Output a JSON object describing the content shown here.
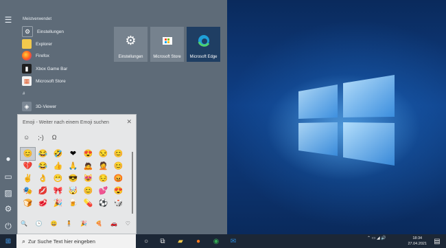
{
  "start_menu": {
    "section_most_used": "Meistverwendet",
    "section_hash": "#",
    "apps": [
      {
        "label": "Einstellungen",
        "icon": "gear-icon"
      },
      {
        "label": "Explorer",
        "icon": "folder-icon"
      },
      {
        "label": "Firefox",
        "icon": "firefox-icon"
      },
      {
        "label": "Xbox Game Bar",
        "icon": "xbox-icon"
      },
      {
        "label": "Microsoft Store",
        "icon": "store-icon"
      },
      {
        "label": "3D-Viewer",
        "icon": "cube-icon"
      }
    ],
    "tiles": [
      {
        "label": "Einstellungen",
        "icon": "gear-icon"
      },
      {
        "label": "Microsoft Store",
        "icon": "store-icon"
      },
      {
        "label": "Microsoft Edge",
        "icon": "edge-icon"
      }
    ]
  },
  "emoji_panel": {
    "header": "Emoji - Weiter nach einem Emoji suchen",
    "tabs": [
      "☺",
      ";-)",
      "Ω"
    ],
    "emojis": [
      "😊",
      "😂",
      "🤣",
      "❤",
      "😍",
      "😒",
      "😊",
      "💔",
      "😂",
      "👍",
      "🙏",
      "🙇",
      "🤦",
      "😊",
      "✌",
      "👌",
      "😁",
      "😎",
      "😻",
      "😔",
      "😡",
      "🎭",
      "💋",
      "🎀",
      "🤯",
      "😊",
      "💕",
      "😍",
      "🍞",
      "🥩",
      "🎉",
      "🍺",
      "💊",
      "⚽",
      "🎲"
    ],
    "categories": [
      "🔍",
      "🕒",
      "😀",
      "🧍",
      "🎉",
      "🍕",
      "🚗",
      "♡"
    ]
  },
  "taskbar": {
    "search_placeholder": "Zur Suche Text hier eingeben",
    "time": "18:34",
    "date": "27.04.2021",
    "colors": {
      "bg": "#1c2736",
      "start_menu": "#5e6b78",
      "edge_tile": "#1f3e63"
    }
  }
}
